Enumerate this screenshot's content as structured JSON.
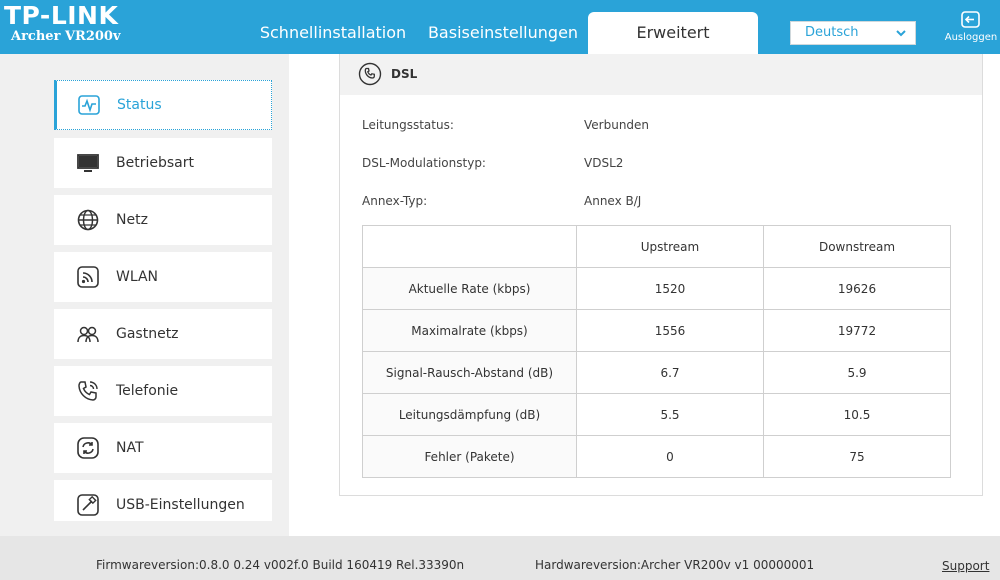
{
  "header": {
    "logo": "TP-LINK",
    "model": "Archer VR200v",
    "tabs": [
      {
        "label": "Schnellinstallation"
      },
      {
        "label": "Basiseinstellungen"
      },
      {
        "label": "Erweitert"
      }
    ],
    "active_tab": "Erweitert",
    "language": "Deutsch",
    "logout_label": "Ausloggen"
  },
  "sidebar": {
    "items": [
      {
        "label": "Status",
        "icon": "activity-icon"
      },
      {
        "label": "Betriebsart",
        "icon": "monitor-icon"
      },
      {
        "label": "Netz",
        "icon": "globe-icon"
      },
      {
        "label": "WLAN",
        "icon": "wireless-icon"
      },
      {
        "label": "Gastnetz",
        "icon": "guests-icon"
      },
      {
        "label": "Telefonie",
        "icon": "phone-icon"
      },
      {
        "label": "NAT",
        "icon": "refresh-icon"
      },
      {
        "label": "USB-Einstellungen",
        "icon": "usb-icon"
      }
    ],
    "active": "Status"
  },
  "dsl": {
    "title": "DSL",
    "fields": [
      {
        "label": "Leitungsstatus:",
        "value": "Verbunden"
      },
      {
        "label": "DSL-Modulationstyp:",
        "value": "VDSL2"
      },
      {
        "label": "Annex-Typ:",
        "value": "Annex B/J"
      }
    ],
    "table": {
      "headers": [
        "",
        "Upstream",
        "Downstream"
      ],
      "rows": [
        {
          "label": "Aktuelle Rate (kbps)",
          "up": "1520",
          "down": "19626"
        },
        {
          "label": "Maximalrate (kbps)",
          "up": "1556",
          "down": "19772"
        },
        {
          "label": "Signal-Rausch-Abstand (dB)",
          "up": "6.7",
          "down": "5.9"
        },
        {
          "label": "Leitungsdämpfung (dB)",
          "up": "5.5",
          "down": "10.5"
        },
        {
          "label": "Fehler (Pakete)",
          "up": "0",
          "down": "75"
        }
      ]
    }
  },
  "footer": {
    "firmware": "Firmwareversion:0.8.0 0.24 v002f.0 Build 160419 Rel.33390n",
    "hardware": "Hardwareversion:Archer VR200v v1 00000001",
    "support": "Support"
  },
  "colors": {
    "accent": "#2aa3d8",
    "sidebar_bg": "#f0f0f0",
    "footer_bg": "#e6e6e6"
  }
}
